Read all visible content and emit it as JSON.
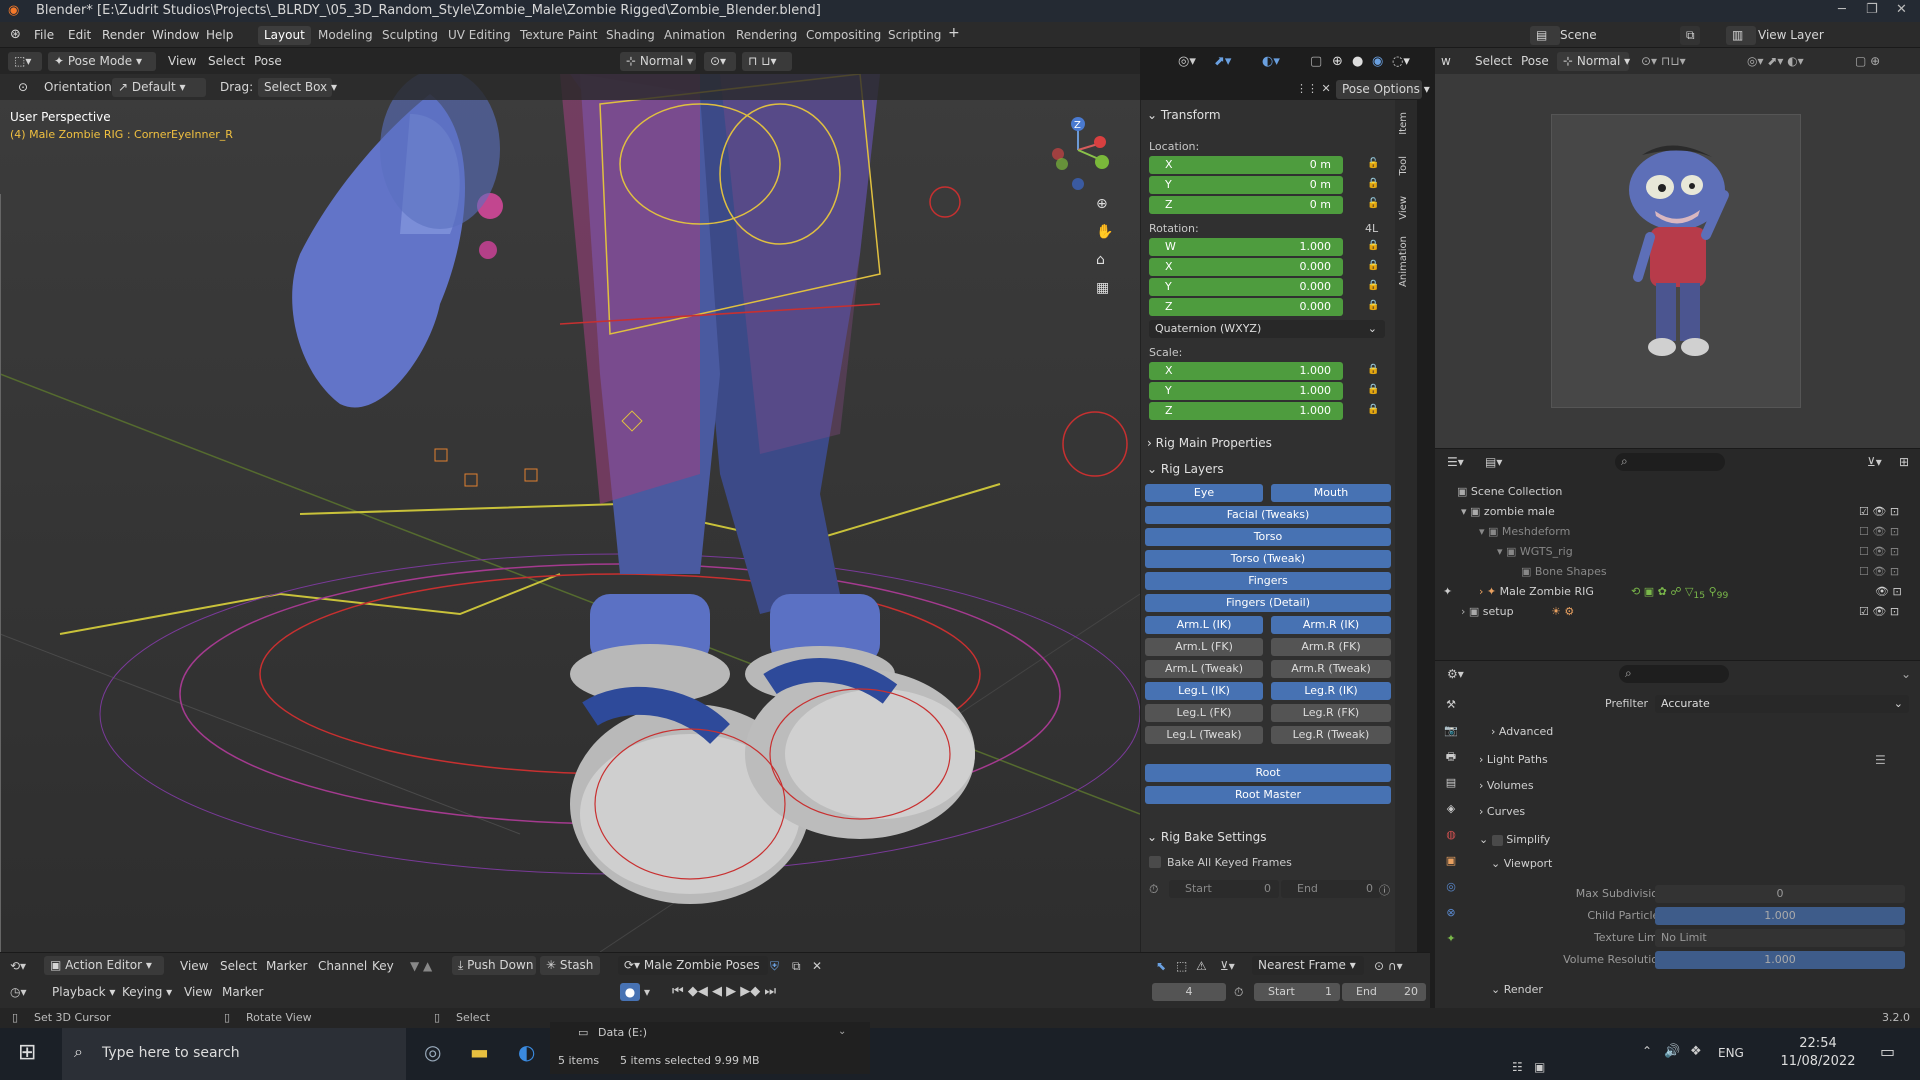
{
  "title": "Blender* [E:\\Zudrit Studios\\Projects\\_BLRDY_\\05_3D_Random_Style\\Zombie_Male\\Zombie Rigged\\Zombie_Blender.blend]",
  "menu": {
    "file": "File",
    "edit": "Edit",
    "render": "Render",
    "window": "Window",
    "help": "Help"
  },
  "workspaces": [
    "Layout",
    "Modeling",
    "Sculpting",
    "UV Editing",
    "Texture Paint",
    "Shading",
    "Animation",
    "Rendering",
    "Compositing",
    "Scripting"
  ],
  "scene": {
    "label": "Scene",
    "view_layer": "View Layer"
  },
  "viewport_header": {
    "mode": "Pose Mode",
    "view": "View",
    "select": "Select",
    "pose": "Pose",
    "transform_orientation": "Normal",
    "pose_options": "Pose Options"
  },
  "tool_settings": {
    "orientation_label": "Orientation:",
    "orientation_value": "Default",
    "drag_label": "Drag:",
    "drag_value": "Select Box"
  },
  "viewport": {
    "perspective": "User Perspective",
    "active": "(4) Male Zombie RIG : CornerEyeInner_R"
  },
  "npanel": {
    "tabs": [
      "Item",
      "Tool",
      "View",
      "Animation"
    ],
    "transform": {
      "title": "Transform",
      "location_label": "Location:",
      "location": [
        {
          "k": "X",
          "v": "0 m"
        },
        {
          "k": "Y",
          "v": "0 m"
        },
        {
          "k": "Z",
          "v": "0 m"
        }
      ],
      "rotation_label": "Rotation:",
      "rotation_4l": "4L",
      "rotation": [
        {
          "k": "W",
          "v": "1.000"
        },
        {
          "k": "X",
          "v": "0.000"
        },
        {
          "k": "Y",
          "v": "0.000"
        },
        {
          "k": "Z",
          "v": "0.000"
        }
      ],
      "rotation_mode": "Quaternion (WXYZ)",
      "scale_label": "Scale:",
      "scale": [
        {
          "k": "X",
          "v": "1.000"
        },
        {
          "k": "Y",
          "v": "1.000"
        },
        {
          "k": "Z",
          "v": "1.000"
        }
      ]
    },
    "rig_main": "Rig Main Properties",
    "rig_layers": {
      "title": "Rig Layers",
      "eye": "Eye",
      "mouth": "Mouth",
      "facial": "Facial (Tweaks)",
      "torso": "Torso",
      "torso_tweak": "Torso (Tweak)",
      "fingers": "Fingers",
      "fingers_detail": "Fingers (Detail)",
      "arm_l_ik": "Arm.L (IK)",
      "arm_r_ik": "Arm.R (IK)",
      "arm_l_fk": "Arm.L (FK)",
      "arm_r_fk": "Arm.R (FK)",
      "arm_l_tw": "Arm.L (Tweak)",
      "arm_r_tw": "Arm.R (Tweak)",
      "leg_l_ik": "Leg.L (IK)",
      "leg_r_ik": "Leg.R (IK)",
      "leg_l_fk": "Leg.L (FK)",
      "leg_r_fk": "Leg.R (FK)",
      "leg_l_tw": "Leg.L (Tweak)",
      "leg_r_tw": "Leg.R (Tweak)",
      "root": "Root",
      "root_master": "Root Master"
    },
    "bake": {
      "title": "Rig Bake Settings",
      "bake_all": "Bake All Keyed Frames",
      "start_label": "Start",
      "start_val": "0",
      "end_label": "End",
      "end_val": "0"
    }
  },
  "camera_header": {
    "select": "Select",
    "pose": "Pose",
    "orientation": "Normal"
  },
  "outliner": {
    "items": [
      {
        "label": "Scene Collection"
      },
      {
        "label": "zombie male"
      },
      {
        "label": "Meshdeform"
      },
      {
        "label": "WGTS_rig"
      },
      {
        "label": "Bone Shapes"
      },
      {
        "label": "Male Zombie RIG"
      },
      {
        "label": "setup"
      }
    ],
    "rig_badge_a": "15",
    "rig_badge_b": "99"
  },
  "properties": {
    "prefilter_label": "Prefilter",
    "prefilter_value": "Accurate",
    "advanced": "Advanced",
    "light_paths": "Light Paths",
    "volumes": "Volumes",
    "curves": "Curves",
    "simplify": "Simplify",
    "viewport": "Viewport",
    "max_subdiv_label": "Max Subdivision",
    "max_subdiv": "0",
    "child_particles_label": "Child Particles",
    "child_particles": "1.000",
    "texture_limit_label": "Texture Limit",
    "texture_limit": "No Limit",
    "volume_res_label": "Volume Resolution",
    "volume_res": "1.000",
    "render": "Render"
  },
  "action_editor": {
    "editor": "Action Editor",
    "view": "View",
    "select": "Select",
    "marker": "Marker",
    "channel": "Channel",
    "key": "Key",
    "push_down": "Push Down",
    "stash": "Stash",
    "action": "Male Zombie Poses",
    "snap": "Nearest Frame"
  },
  "playback": {
    "playback": "Playback",
    "keying": "Keying",
    "view": "View",
    "marker": "Marker",
    "frame": "4",
    "start_label": "Start",
    "start": "1",
    "end_label": "End",
    "end": "20"
  },
  "status": {
    "set_cursor": "Set 3D Cursor",
    "rotate": "Rotate View",
    "select": "Select",
    "version": "3.2.0"
  },
  "explorer": {
    "drive": "Data (E:)",
    "items": "5 items",
    "selected": "5 items selected  9.99 MB"
  },
  "taskbar": {
    "search": "Type here to search",
    "lang": "ENG",
    "time": "22:54",
    "date": "11/08/2022"
  }
}
